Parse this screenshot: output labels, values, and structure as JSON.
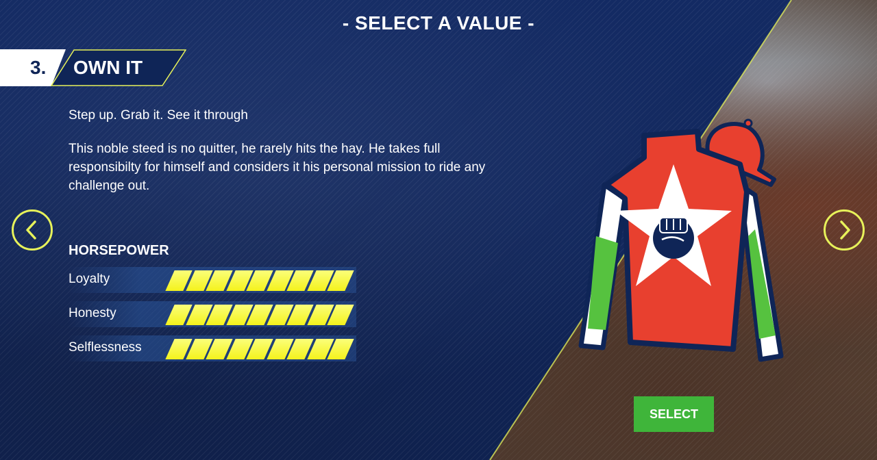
{
  "header": {
    "title": "- SELECT A VALUE -"
  },
  "value": {
    "number": "3.",
    "name": "OWN IT",
    "tagline": "Step up. Grab it. See it through",
    "description": "This noble steed is no quitter, he rarely hits the hay. He takes full responsibilty for himself and considers it his personal mission to ride any challenge out."
  },
  "horsepower": {
    "heading": "HORSEPOWER",
    "stats": [
      {
        "label": "Loyalty",
        "level": 9,
        "max": 9
      },
      {
        "label": "Honesty",
        "level": 9,
        "max": 9
      },
      {
        "label": "Selflessness",
        "level": 9,
        "max": 9
      }
    ]
  },
  "silks": {
    "icon": "raised-fist-icon",
    "colors": {
      "body": "#e8402f",
      "star": "#ffffff",
      "sleeves": "#56c23f",
      "outline": "#0f2557"
    }
  },
  "nav": {
    "prev_icon": "chevron-left-icon",
    "next_icon": "chevron-right-icon"
  },
  "actions": {
    "select_label": "SELECT"
  },
  "theme": {
    "accent": "#e7f25a",
    "background": "#0f2557",
    "select_green": "#3fb53a"
  }
}
